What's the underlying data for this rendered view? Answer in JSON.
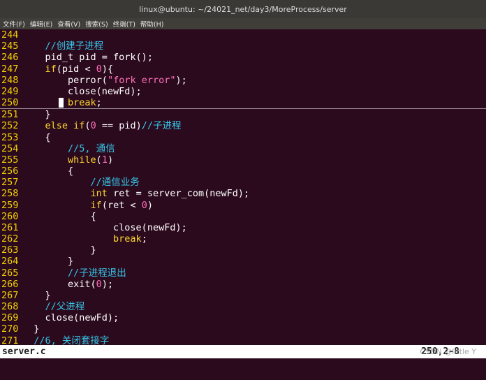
{
  "window": {
    "title": "linux@ubuntu: ~/24021_net/day3/MoreProcess/server"
  },
  "menu": [
    "文件(F)",
    "编辑(E)",
    "查看(V)",
    "搜索(S)",
    "终端(T)",
    "帮助(H)"
  ],
  "lines": [
    {
      "num": "244"
    },
    {
      "num": "245",
      "text": "    //创建子进程"
    },
    {
      "num": "246",
      "text": "    pid_t pid = fork();"
    },
    {
      "num": "247",
      "text": "    if(pid < 0){"
    },
    {
      "num": "248",
      "text": "        perror(\"fork error\");"
    },
    {
      "num": "249",
      "text": "        close(newFd);"
    },
    {
      "num": "250",
      "text": "        break;"
    },
    {
      "num": "251",
      "text": "    }"
    },
    {
      "num": "252",
      "text": "    else if(0 == pid)//子进程"
    },
    {
      "num": "253",
      "text": "    {"
    },
    {
      "num": "254",
      "text": "        //5, 通信"
    },
    {
      "num": "255",
      "text": "        while(1)"
    },
    {
      "num": "256",
      "text": "        {"
    },
    {
      "num": "257",
      "text": "            //通信业务"
    },
    {
      "num": "258",
      "text": "            int ret = server_com(newFd);"
    },
    {
      "num": "259",
      "text": "            if(ret < 0)"
    },
    {
      "num": "260",
      "text": "            {"
    },
    {
      "num": "261",
      "text": "                close(newFd);"
    },
    {
      "num": "262",
      "text": "                break;"
    },
    {
      "num": "263",
      "text": "            }"
    },
    {
      "num": "264",
      "text": "        }"
    },
    {
      "num": "265",
      "text": "        //子进程退出"
    },
    {
      "num": "266",
      "text": "        exit(0);"
    },
    {
      "num": "267",
      "text": "    }"
    },
    {
      "num": "268",
      "text": "    //父进程"
    },
    {
      "num": "269",
      "text": "    close(newFd);"
    },
    {
      "num": "270",
      "text": "}"
    },
    {
      "num": "271",
      "text": "//6, 关闭套接字"
    }
  ],
  "frag": {
    "l246": "pid_t pid = fork();",
    "if": "if",
    "open_paren": "(",
    "pid": "pid",
    "lt": " < ",
    "zero": "0",
    "close_brace_paren": "){",
    "perror_open": "perror(",
    "fork_error": "\"fork error\"",
    "close_semi": ");",
    "close_newfd": "close(newFd);",
    "break": "break",
    "semi": ";",
    "brace_close": "}",
    "brace_open": "{",
    "else_if": "else if",
    "eq_pid": " == pid)",
    "c245": "//创建子进程",
    "c252": "//子进程",
    "c254": "//5, 通信",
    "while": "while",
    "one": "1",
    "close_paren": ")",
    "c257": "//通信业务",
    "int": "int",
    "ret_assign": " ret = server_com(newFd);",
    "ret": "ret",
    "c265": "//子进程退出",
    "exit_open": "exit(",
    "c268": "//父进程",
    "c271": "//6, 关闭套接字"
  },
  "status": {
    "filename": "server.c",
    "position": "250,2-8"
  },
  "watermark": "CSDN @little Y",
  "colors": {
    "background": "#2c0a1e",
    "line_number": "#f2d200",
    "comment": "#35c6e8",
    "keyword": "#ffd92e",
    "string": "#ff6fb8"
  }
}
